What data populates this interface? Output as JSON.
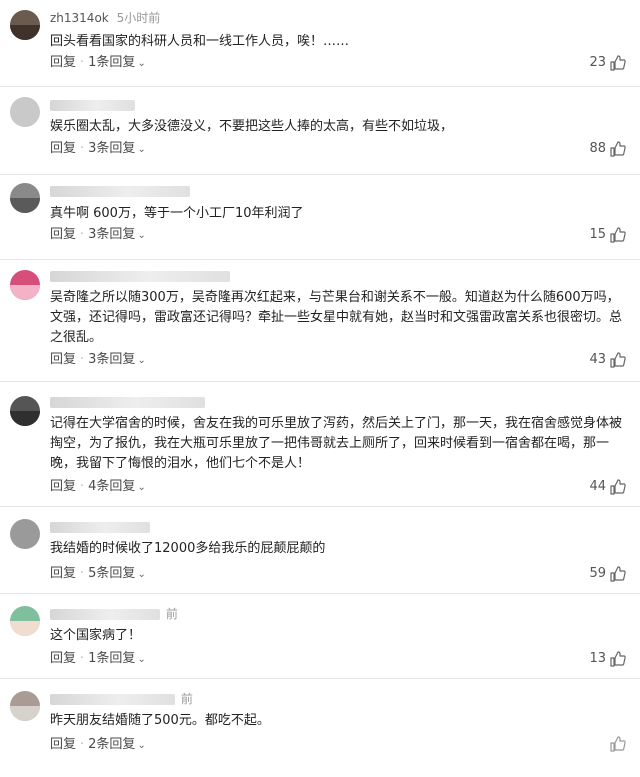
{
  "comments": [
    {
      "user": "zh1314ok",
      "time": "5小时前",
      "text": "回头看看国家的科研人员和一线工作人员，唉！……",
      "reply": "回复",
      "replies": "1条回复",
      "likes": "23"
    },
    {
      "user": "",
      "time": "",
      "text": "娱乐圈太乱，大多没德没义，不要把这些人捧的太高，有些不如垃圾，",
      "reply": "回复",
      "replies": "3条回复",
      "likes": "88"
    },
    {
      "user": "",
      "time": "",
      "text": "真牛啊 600万，等于一个小工厂10年利润了",
      "reply": "回复",
      "replies": "3条回复",
      "likes": "15"
    },
    {
      "user": "",
      "time": "",
      "text": "吴奇隆之所以随300万，吴奇隆再次红起来，与芒果台和谢关系不一般。知道赵为什么随600万吗，文强，还记得吗，雷政富还记得吗？牵扯一些女星中就有她，赵当时和文强雷政富关系也很密切。总之很乱。",
      "reply": "回复",
      "replies": "3条回复",
      "likes": "43"
    },
    {
      "user": "",
      "time": "",
      "text": "记得在大学宿舍的时候，舍友在我的可乐里放了泻药，然后关上了门，那一天，我在宿舍感觉身体被掏空，为了报仇，我在大瓶可乐里放了一把伟哥就去上厕所了，回来时候看到一宿舍都在喝，那一晚，我留下了悔恨的泪水，他们七个不是人！",
      "reply": "回复",
      "replies": "4条回复",
      "likes": "44"
    },
    {
      "user": "",
      "time": "",
      "text": "我结婚的时候收了12000多给我乐的屁颠屁颠的",
      "reply": "回复",
      "replies": "5条回复",
      "likes": "59"
    },
    {
      "user": "",
      "time": "前",
      "text": "这个国家病了！",
      "reply": "回复",
      "replies": "1条回复",
      "likes": "13"
    },
    {
      "user": "",
      "time": "前",
      "text": "昨天朋友结婚随了500元。都吃不起。",
      "reply": "回复",
      "replies": "2条回复",
      "likes": ""
    }
  ],
  "colors": {
    "avatar1": "#6b5a4e",
    "avatar2": "#c9c9c9",
    "avatar3": "#8a8a8a",
    "avatar4": "#d64f7a",
    "avatar5": "#555555",
    "avatar6": "#9a9a9a",
    "avatar7": "#7fbf9c",
    "avatar8": "#a89c94"
  }
}
